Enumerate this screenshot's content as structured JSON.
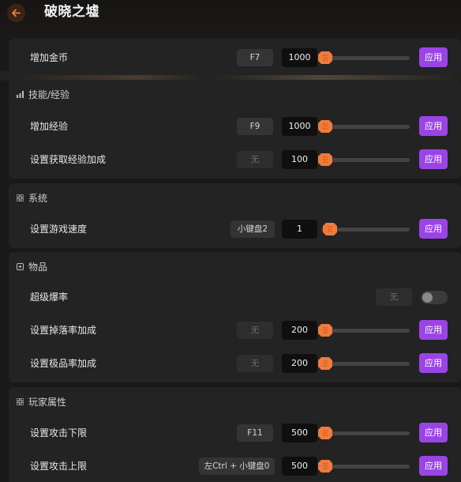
{
  "header": {
    "title": "破晓之墟"
  },
  "apply_label": "应用",
  "sections": [
    {
      "title": "",
      "rows": [
        {
          "label": "增加金币",
          "hotkey": "F7",
          "value": "1000",
          "slider": 0.02
        }
      ]
    },
    {
      "title": "技能/经验",
      "icon": "bar-chart-icon",
      "rows": [
        {
          "label": "增加经验",
          "hotkey": "F9",
          "value": "1000",
          "slider": 0.02
        },
        {
          "label": "设置获取经验加成",
          "hotkey": "无",
          "value": "100",
          "slider": 0.02
        }
      ]
    },
    {
      "title": "系统",
      "icon": "grid-icon",
      "rows": [
        {
          "label": "设置游戏速度",
          "hotkey": "小键盘2",
          "value": "1",
          "slider": 0.02
        }
      ]
    },
    {
      "title": "物品",
      "icon": "item-box-icon",
      "rows": [
        {
          "label": "超级爆率",
          "hotkey": "无",
          "toggle": false
        },
        {
          "label": "设置掉落率加成",
          "hotkey": "无",
          "value": "200",
          "slider": 0.02
        },
        {
          "label": "设置极品率加成",
          "hotkey": "无",
          "value": "200",
          "slider": 0.02
        }
      ]
    },
    {
      "title": "玩家属性",
      "icon": "grid-icon",
      "rows": [
        {
          "label": "设置攻击下限",
          "hotkey": "F11",
          "value": "500",
          "slider": 0.02
        },
        {
          "label": "设置攻击上限",
          "hotkey": "左Ctrl + 小键盘0",
          "value": "500",
          "slider": 0.02
        }
      ]
    }
  ],
  "colors": {
    "accent": "#9b44e6",
    "slider_thumb": "#f07b3c",
    "back_button": "#ff8a3d"
  }
}
